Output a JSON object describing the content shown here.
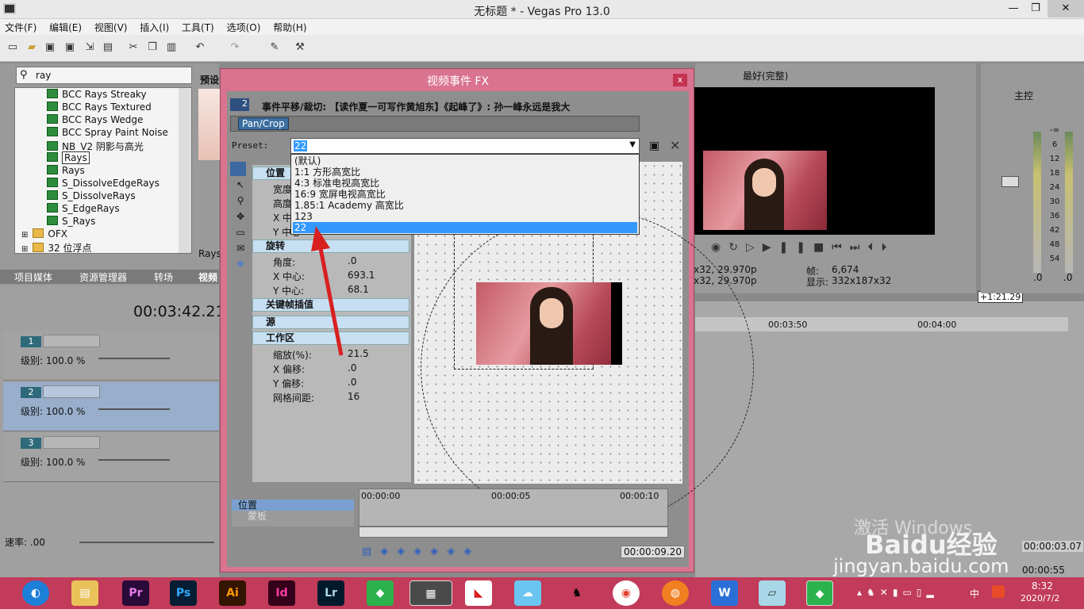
{
  "window": {
    "title": "无标题 * - Vegas Pro 13.0",
    "min": "—",
    "max": "❐",
    "close": "✕"
  },
  "menu": [
    "文件(F)",
    "编辑(E)",
    "视图(V)",
    "插入(I)",
    "工具(T)",
    "选项(O)",
    "帮助(H)"
  ],
  "search": {
    "value": "ray",
    "preset_label": "预设"
  },
  "tree_items": [
    {
      "label": "BCC Rays Streaky",
      "type": "fx"
    },
    {
      "label": "BCC Rays Textured",
      "type": "fx"
    },
    {
      "label": "BCC Rays Wedge",
      "type": "fx"
    },
    {
      "label": "BCC Spray Paint Noise",
      "type": "fx"
    },
    {
      "label": "NB_V2 阴影与高光",
      "type": "fx"
    },
    {
      "label": "Rays",
      "type": "fx",
      "selected": true
    },
    {
      "label": "Rays",
      "type": "fx"
    },
    {
      "label": "S_DissolveEdgeRays",
      "type": "fx"
    },
    {
      "label": "S_DissolveRays",
      "type": "fx"
    },
    {
      "label": "S_EdgeRays",
      "type": "fx"
    },
    {
      "label": "S_Rays",
      "type": "fx"
    },
    {
      "label": "OFX",
      "type": "folder"
    },
    {
      "label": "32 位浮点",
      "type": "folder"
    }
  ],
  "tree_caption": "Rays",
  "bottom_tabs": [
    "项目媒体",
    "资源管理器",
    "转场",
    "视频"
  ],
  "timecode": "00:03:42.21",
  "tracks": [
    {
      "num": "1",
      "level": "级别: 100.0 %"
    },
    {
      "num": "2",
      "level": "级别: 100.0 %"
    },
    {
      "num": "3",
      "level": "级别: 100.0 %"
    }
  ],
  "rate": "速率: .00",
  "dialog": {
    "title": "视频事件 FX",
    "close": "x",
    "event_num": "2",
    "header": "事件平移/裁切: 【读作夏一可写作黄旭东】《起峰了》: 孙一峰永远是我大",
    "pancrop": "Pan/Crop",
    "preset_label": "Preset:",
    "preset_value": "22",
    "options": [
      "(默认)",
      "1:1 方形高宽比",
      "4:3 标准电视高宽比",
      "16:9 宽屏电视高宽比",
      "1.85:1 Academy 高宽比",
      "123",
      "22"
    ],
    "sections": {
      "position": "位置",
      "rotation": "旋转",
      "keyframe": "关键帧插值",
      "source": "源",
      "workspace": "工作区"
    },
    "pos_rows": [
      "宽度",
      "高度",
      "X 中心",
      "Y 中心"
    ],
    "rotation_rows": [
      {
        "k": "角度:",
        "v": ".0"
      },
      {
        "k": "X 中心:",
        "v": "693.1"
      },
      {
        "k": "Y 中心:",
        "v": "68.1"
      }
    ],
    "workspace_rows": [
      {
        "k": "缩放(%):",
        "v": "21.5"
      },
      {
        "k": "X 偏移:",
        "v": ".0"
      },
      {
        "k": "Y 偏移:",
        "v": ".0"
      },
      {
        "k": "网格间距:",
        "v": "16"
      }
    ],
    "timeline_marks": [
      "00:00:00",
      "00:00:05",
      "00:00:10"
    ],
    "track_labels": [
      "位置",
      "蒙板"
    ],
    "end_time": "00:00:09.20"
  },
  "preview": {
    "quality": "最好(完整)",
    "info_left1": "x32, 29.970p",
    "info_left2": "x32, 29.970p",
    "frame_label": "帧:",
    "frame_value": "6,674",
    "display_label": "显示:",
    "display_value": "332x187x32"
  },
  "master": {
    "label": "主控",
    "scale": [
      "-∞",
      "6",
      "12",
      "18",
      "24",
      "30",
      "36",
      "42",
      "48",
      "54"
    ],
    "left_val": ".0",
    "right_val": ".0"
  },
  "timeline": {
    "marker": "+1:21.29",
    "t1": "00:03:50",
    "t2": "00:04:00",
    "right_time": "00:00:03.07",
    "bottom_time": "00:00:55"
  },
  "watermark": {
    "top": "激活 Windows",
    "brand": "Baidu经验",
    "url": "jingyan.baidu.com"
  },
  "tray": {
    "time": "8:32",
    "date": "2020/7/2",
    "ime": "中"
  },
  "taskbar_apps": [
    "Pr",
    "Ps",
    "Ai",
    "Id",
    "Lr"
  ]
}
